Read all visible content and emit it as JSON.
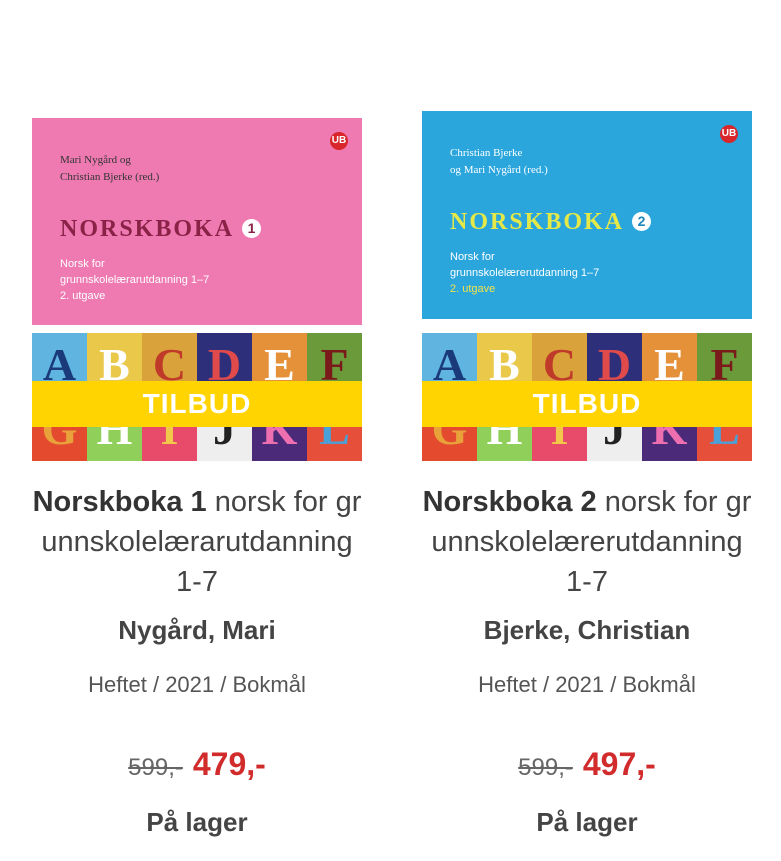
{
  "products": [
    {
      "cover": {
        "authors_line1": "Mari Nygård og",
        "authors_line2": "Christian Bjerke (red.)",
        "title": "NORSKBOKA",
        "volume": "1",
        "subtitle_line1": "Norsk for",
        "subtitle_line2": "grunnskolelærarutdanning 1–7",
        "edition": "2. utgave",
        "publisher_logo": "UB",
        "colors": {
          "top": "#ee7ab1",
          "title": "#8a2248"
        }
      },
      "badge": "TILBUD",
      "title_bold": "Norskboka 1",
      "title_rest": " norsk for grunnskolelærarutdanning 1-7",
      "author": "Nygård, Mari",
      "meta": "Heftet / 2021 / Bokmål",
      "price_old": "599,-",
      "price_new": "479,-",
      "stock": "På lager"
    },
    {
      "cover": {
        "authors_line1": "Christian Bjerke",
        "authors_line2": "og Mari Nygård (red.)",
        "title": "NORSKBOKA",
        "volume": "2",
        "subtitle_line1": "Norsk for",
        "subtitle_line2": "grunnskolelærerutdanning 1–7",
        "edition": "2. utgave",
        "publisher_logo": "UB",
        "colors": {
          "top": "#2aa6dd",
          "title": "#e5e948"
        }
      },
      "badge": "TILBUD",
      "title_bold": "Norskboka 2",
      "title_rest": " norsk for grunnskolelærerutdanning 1-7",
      "author": "Bjerke, Christian",
      "meta": "Heftet / 2021 / Bokmål",
      "price_old": "599,-",
      "price_new": "497,-",
      "stock": "På lager"
    }
  ],
  "cover_letters": [
    "A",
    "B",
    "C",
    "D",
    "E",
    "F",
    "G",
    "H",
    "I",
    "J",
    "K",
    "L"
  ],
  "colors": {
    "badge": "#ffd400",
    "sale_price": "#d22b2b"
  }
}
